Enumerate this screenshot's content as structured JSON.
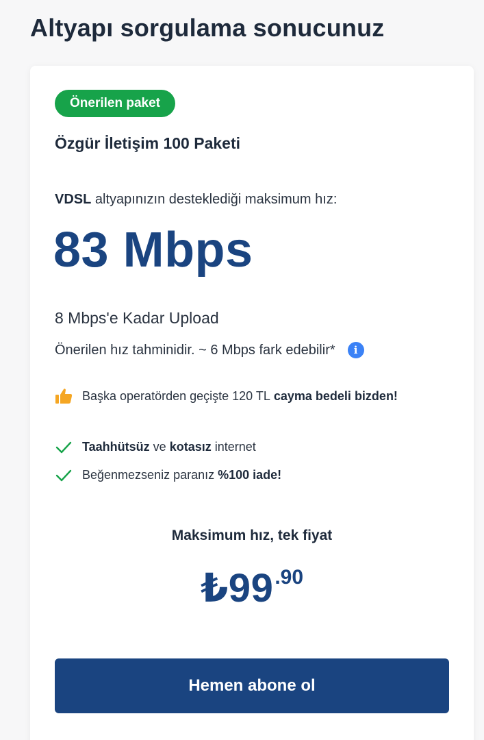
{
  "page": {
    "title": "Altyapı sorgulama sonucunuz"
  },
  "card": {
    "badge": "Önerilen paket",
    "package_name": "Özgür İletişim 100 Paketi",
    "infra_type": "VDSL",
    "infra_text": " altyapınızın desteklediği maksimum hız:",
    "speed": "83 Mbps",
    "upload": "8 Mbps'e Kadar Upload",
    "estimate": "Önerilen hız tahminidir. ~ 6 Mbps fark edebilir*",
    "info_icon": "i",
    "promo": {
      "text": "Başka operatörden geçişte 120 TL ",
      "bold": "cayma bedeli bizden!"
    },
    "features": [
      {
        "b1": "Taahhütsüz",
        "t1": " ve ",
        "b2": "kotasız",
        "t2": " internet"
      },
      {
        "t0": "Beğenmezseniz paranız ",
        "b1": "%100 iade!"
      }
    ],
    "price_caption": "Maksimum hız, tek fiyat",
    "price_main": "₺99",
    "price_cents": ".90",
    "cta": "Hemen abone ol"
  },
  "colors": {
    "brand": "#1a4480",
    "badge": "#17a34a",
    "info": "#3b82f6",
    "check": "#17a34a",
    "thumb": "#f5a623"
  },
  "icons": [
    "info-icon",
    "thumbs-up-icon",
    "check-icon"
  ]
}
